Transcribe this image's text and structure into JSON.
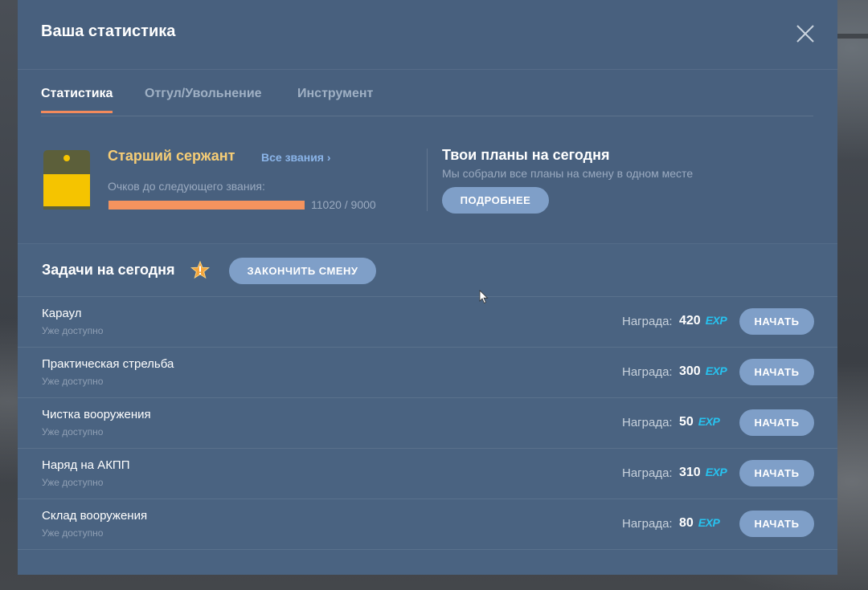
{
  "modal": {
    "title": "Ваша статистика",
    "close_icon": "close-icon"
  },
  "tabs": [
    {
      "label": "Статистика",
      "active": true
    },
    {
      "label": "Отгул/Увольнение",
      "active": false
    },
    {
      "label": "Инструмент",
      "active": false
    }
  ],
  "rank": {
    "name": "Старший сержант",
    "all_ranks_label": "Все звания ›",
    "points_label": "Очков до следующего звания:",
    "points_value": "11020 / 9000",
    "progress_fraction": 1.0,
    "icon": "rank-badge-icon",
    "colors": {
      "badge_top": "#5c5f3a",
      "badge_bottom": "#f5c400",
      "progress": "#f4935e"
    }
  },
  "plans": {
    "title": "Твои планы на сегодня",
    "subtitle": "Мы собрали все планы на смену в одном месте",
    "button_label": "ПОДРОБНЕЕ"
  },
  "tasks": {
    "title": "Задачи на сегодня",
    "star_icon": "star-exclamation-icon",
    "end_shift_label": "ЗАКОНЧИТЬ СМЕНУ",
    "items": [
      {
        "name": "Караул",
        "status": "Уже доступно",
        "reward_label": "Награда:",
        "reward": "420",
        "unit": "EXP",
        "button": "НАЧАТЬ"
      },
      {
        "name": "Практическая стрельба",
        "status": "Уже доступно",
        "reward_label": "Награда:",
        "reward": "300",
        "unit": "EXP",
        "button": "НАЧАТЬ"
      },
      {
        "name": "Чистка вооружения",
        "status": "Уже доступно",
        "reward_label": "Награда:",
        "reward": "50",
        "unit": "EXP",
        "button": "НАЧАТЬ"
      },
      {
        "name": "Наряд на АКПП",
        "status": "Уже доступно",
        "reward_label": "Награда:",
        "reward": "310",
        "unit": "EXP",
        "button": "НАЧАТЬ"
      },
      {
        "name": "Склад вооружения",
        "status": "Уже доступно",
        "reward_label": "Награда:",
        "reward": "80",
        "unit": "EXP",
        "button": "НАЧАТЬ"
      }
    ]
  },
  "theme": {
    "panel": "#48607e",
    "accent_tab": "#f28a5c",
    "button": "#7f9fc8",
    "exp": "#27c3f0",
    "rank_name": "#f6cd76"
  }
}
